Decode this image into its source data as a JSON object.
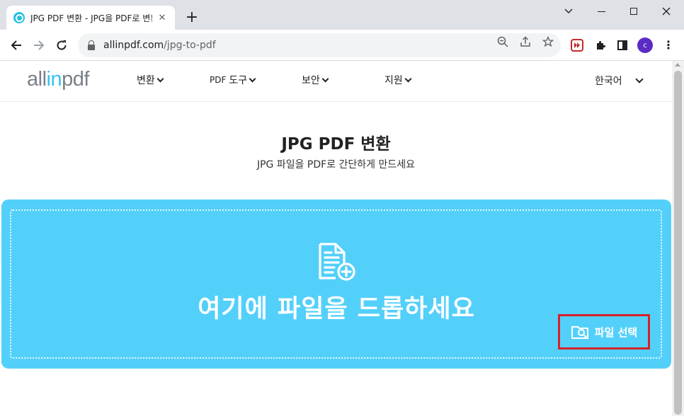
{
  "browser": {
    "tab_title": "JPG PDF 변환 - JPG을 PDF로 변환",
    "tab_close": "✕",
    "new_tab": "+",
    "url_host": "allinpdf.com",
    "url_path": "/jpg-to-pdf",
    "profile_initial": "c"
  },
  "site": {
    "logo_a": "all",
    "logo_b": "in",
    "logo_c": "pdf",
    "nav": {
      "convert": "변환",
      "pdf_tools_a": "PDF",
      "pdf_tools_b": "도구",
      "security": "보안",
      "support": "지원"
    },
    "language": "한국어"
  },
  "hero": {
    "title": "JPG PDF 변환",
    "subtitle": "JPG 파일을 PDF로 간단하게 만드세요"
  },
  "dropzone": {
    "text": "여기에 파일을 드롭하세요",
    "select_button": "파일 선택"
  },
  "colors": {
    "dropzone_bg": "#53d0fa",
    "highlight_border": "#d8202a",
    "logo_accent": "#36c3ee"
  }
}
